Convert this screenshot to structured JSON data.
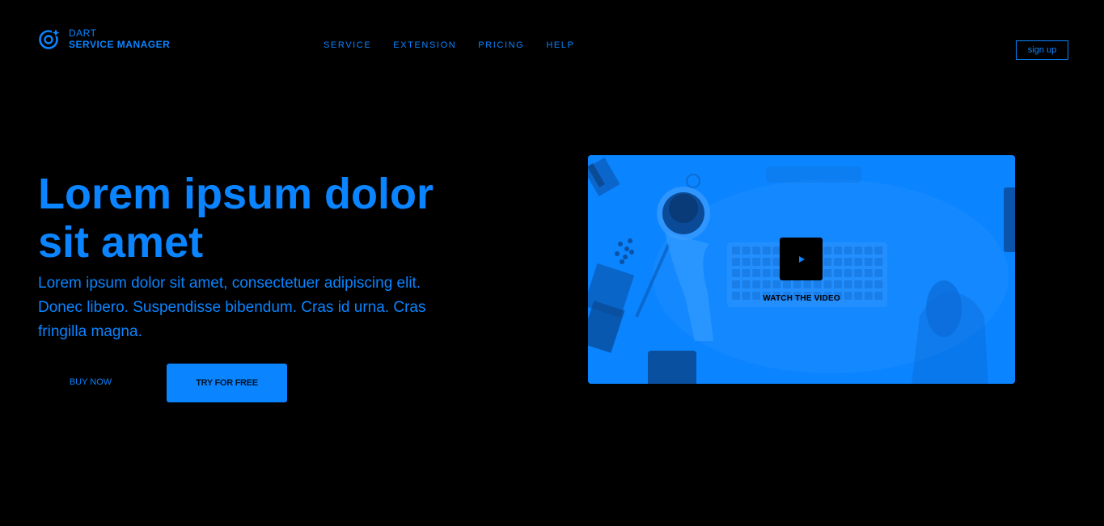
{
  "brand": {
    "line1": "DART",
    "line2": "SERVICE MANAGER",
    "icon": "target-sparkle-icon"
  },
  "nav": {
    "items": [
      {
        "label": "SERVICE"
      },
      {
        "label": "EXTENSION"
      },
      {
        "label": "PRICING"
      },
      {
        "label": "HELP"
      }
    ]
  },
  "header": {
    "signup_label": "sign up"
  },
  "hero": {
    "title": "Lorem ipsum dolor sit amet",
    "text": "Lorem ipsum dolor sit amet, consectetuer adipiscing elit. Donec libero. Suspendisse bibendum. Cras id urna. Cras fringilla magna.",
    "buy_label": "BUY NOW",
    "try_label": "TRY FOR FREE"
  },
  "video": {
    "watch_label": "WATCH THE VIDEO",
    "play_icon": "play-icon"
  },
  "colors": {
    "accent": "#0a84ff",
    "background": "#000000"
  }
}
